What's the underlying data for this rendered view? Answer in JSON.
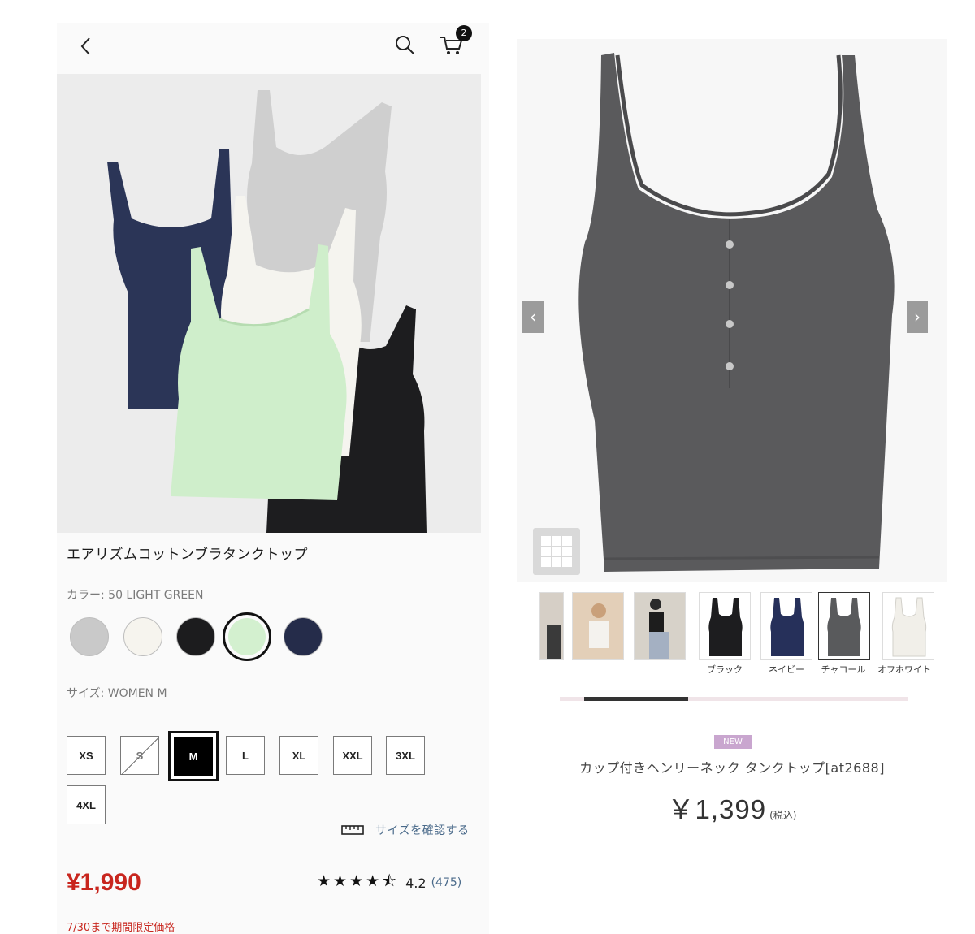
{
  "left": {
    "cart_count": "2",
    "product_title": "エアリズムコットンブラタンクトップ",
    "color_label": "カラー: 50 LIGHT GREEN",
    "colors": [
      {
        "name": "gray",
        "hex": "#c9c9c9",
        "selected": false
      },
      {
        "name": "off-white",
        "hex": "#f6f4ee",
        "selected": false
      },
      {
        "name": "black",
        "hex": "#1c1c1e",
        "selected": false
      },
      {
        "name": "light-green",
        "hex": "#d3f0cf",
        "selected": true
      },
      {
        "name": "navy",
        "hex": "#252c4a",
        "selected": false
      }
    ],
    "size_label": "サイズ: WOMEN M",
    "sizes": [
      {
        "label": "XS",
        "state": "available"
      },
      {
        "label": "S",
        "state": "unavailable"
      },
      {
        "label": "M",
        "state": "selected"
      },
      {
        "label": "L",
        "state": "available"
      },
      {
        "label": "XL",
        "state": "available"
      },
      {
        "label": "XXL",
        "state": "available"
      },
      {
        "label": "3XL",
        "state": "available"
      },
      {
        "label": "4XL",
        "state": "available"
      }
    ],
    "size_check_text": "サイズを確認する",
    "price": "¥1,990",
    "rating_stars": 4.2,
    "rating_value": "4.2",
    "rating_count": "(475)",
    "promo_note": "7/30まで期間限定価格"
  },
  "right": {
    "thumb_labels": [
      "ブラック",
      "ネイビー",
      "チャコール",
      "オフホワイト"
    ],
    "badge": "NEW",
    "product_title": "カップ付きヘンリーネック タンクトップ[at2688]",
    "price": "￥1,399",
    "tax_note": "(税込)"
  },
  "colors": {
    "accent_red": "#c8261e",
    "link_blue": "#4a6a8a"
  }
}
